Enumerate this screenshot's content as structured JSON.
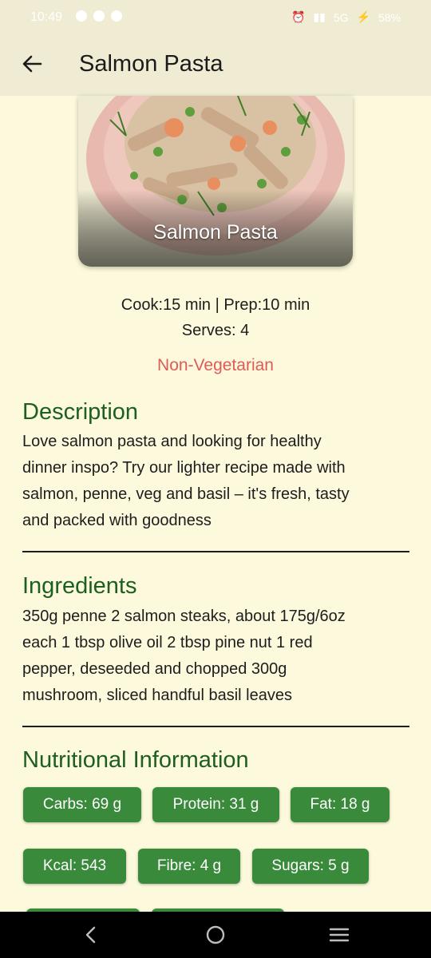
{
  "status": {
    "time": "10:49",
    "battery": "58%",
    "network": "5G"
  },
  "header": {
    "title": "Salmon Pasta"
  },
  "hero": {
    "caption": "Salmon Pasta"
  },
  "meta": {
    "times": "Cook:15 min | Prep:10 min",
    "serves": "Serves: 4"
  },
  "diet": "Non-Vegetarian",
  "description": {
    "title": "Description",
    "lines": [
      "Love salmon pasta and looking for healthy",
      "dinner inspo? Try our lighter recipe made with",
      "salmon, penne, veg and basil – it's fresh, tasty",
      "and packed with goodness"
    ]
  },
  "ingredients": {
    "title": "Ingredients",
    "lines": [
      "350g penne 2 salmon steaks, about 175g/6oz",
      "each 1 tbsp olive oil 2 tbsp pine nut 1 red",
      "pepper, deseeded and chopped 300g",
      "mushroom, sliced handful basil leaves"
    ]
  },
  "nutrition": {
    "title": "Nutritional Information",
    "items": [
      "Carbs: 69 g",
      "Protein: 31 g",
      "Fat: 18 g",
      "Kcal: 543",
      "Fibre: 4 g",
      "Sugars: 5 g"
    ]
  },
  "colors": {
    "background": "#fdf9dc",
    "appbar": "#efecd3",
    "accent_green": "#1d5e21",
    "chip_green": "#3a8a3b",
    "diet_red": "#e05a57"
  }
}
